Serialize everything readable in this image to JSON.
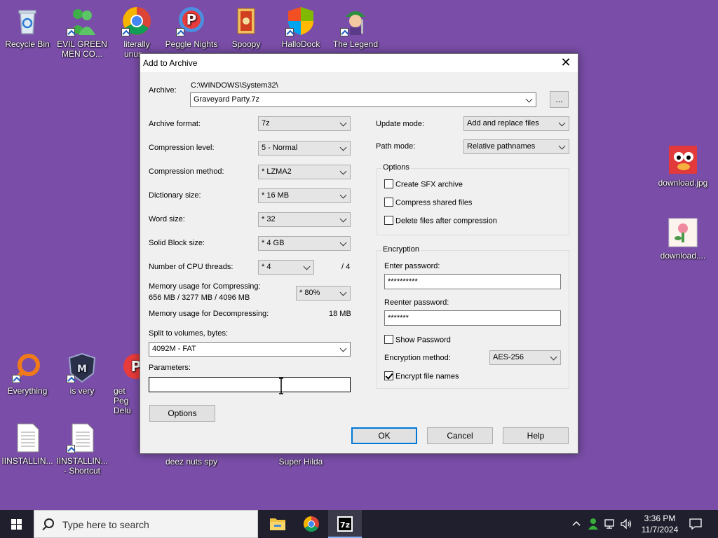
{
  "desktop": {
    "icons": [
      {
        "label": "Recycle Bin"
      },
      {
        "label": "EVIL GREEN MEN CO..."
      },
      {
        "label": "literally unus..."
      },
      {
        "label": "Peggle Nights"
      },
      {
        "label": "Spoopy"
      },
      {
        "label": "HalloDock"
      },
      {
        "label": "The Legend"
      },
      {
        "label": "download.jpg"
      },
      {
        "label": "download...."
      },
      {
        "label": "Everything"
      },
      {
        "label": "is very"
      },
      {
        "label": "get Peg Delu"
      },
      {
        "label": "IINSTALLIN..."
      },
      {
        "label": "IINSTALLIN... - Shortcut"
      },
      {
        "label": "deez nuts spy"
      },
      {
        "label": "Super Hilda"
      }
    ]
  },
  "dialog": {
    "title": "Add to Archive",
    "close_glyph": "✕",
    "archive": {
      "label": "Archive:",
      "path": "C:\\WINDOWS\\System32\\",
      "filename": "Graveyard Party.7z",
      "browse_label": "..."
    },
    "left": {
      "archive_format": {
        "label": "Archive format:",
        "value": "7z"
      },
      "compression_level": {
        "label": "Compression level:",
        "value": "5 - Normal"
      },
      "compression_method": {
        "label": "Compression method:",
        "value": "*  LZMA2"
      },
      "dictionary_size": {
        "label": "Dictionary size:",
        "value": "*  16 MB"
      },
      "word_size": {
        "label": "Word size:",
        "value": "*  32"
      },
      "solid_block": {
        "label": "Solid Block size:",
        "value": "*  4 GB"
      },
      "cpu_threads": {
        "label": "Number of CPU threads:",
        "value": "*  4",
        "max": "/ 4"
      },
      "mem_compress": {
        "label": "Memory usage for Compressing:",
        "detail": "656 MB / 3277 MB / 4096 MB",
        "value": "*  80%"
      },
      "mem_decompress": {
        "label": "Memory usage for Decompressing:",
        "value": "18 MB"
      },
      "split": {
        "label": "Split to volumes, bytes:",
        "value": "4092M - FAT"
      },
      "parameters": {
        "label": "Parameters:",
        "value": ""
      },
      "options_button": "Options"
    },
    "right": {
      "update_mode": {
        "label": "Update mode:",
        "value": "Add and replace files"
      },
      "path_mode": {
        "label": "Path mode:",
        "value": "Relative pathnames"
      },
      "options_group": "Options",
      "create_sfx": {
        "label": "Create SFX archive",
        "checked": false
      },
      "compress_shared": {
        "label": "Compress shared files",
        "checked": false
      },
      "delete_after": {
        "label": "Delete files after compression",
        "checked": false
      },
      "encryption_group": "Encryption",
      "enter_password": {
        "label": "Enter password:",
        "value": "**********"
      },
      "reenter_password": {
        "label": "Reenter password:",
        "value": "*******"
      },
      "show_password": {
        "label": "Show Password",
        "checked": false
      },
      "encryption_method": {
        "label": "Encryption method:",
        "value": "AES-256"
      },
      "encrypt_names": {
        "label": "Encrypt file names",
        "checked": true
      }
    },
    "buttons": {
      "ok": "OK",
      "cancel": "Cancel",
      "help": "Help"
    }
  },
  "taskbar": {
    "search_placeholder": "Type here to search",
    "time": "3:36 PM",
    "date": "11/7/2024"
  }
}
